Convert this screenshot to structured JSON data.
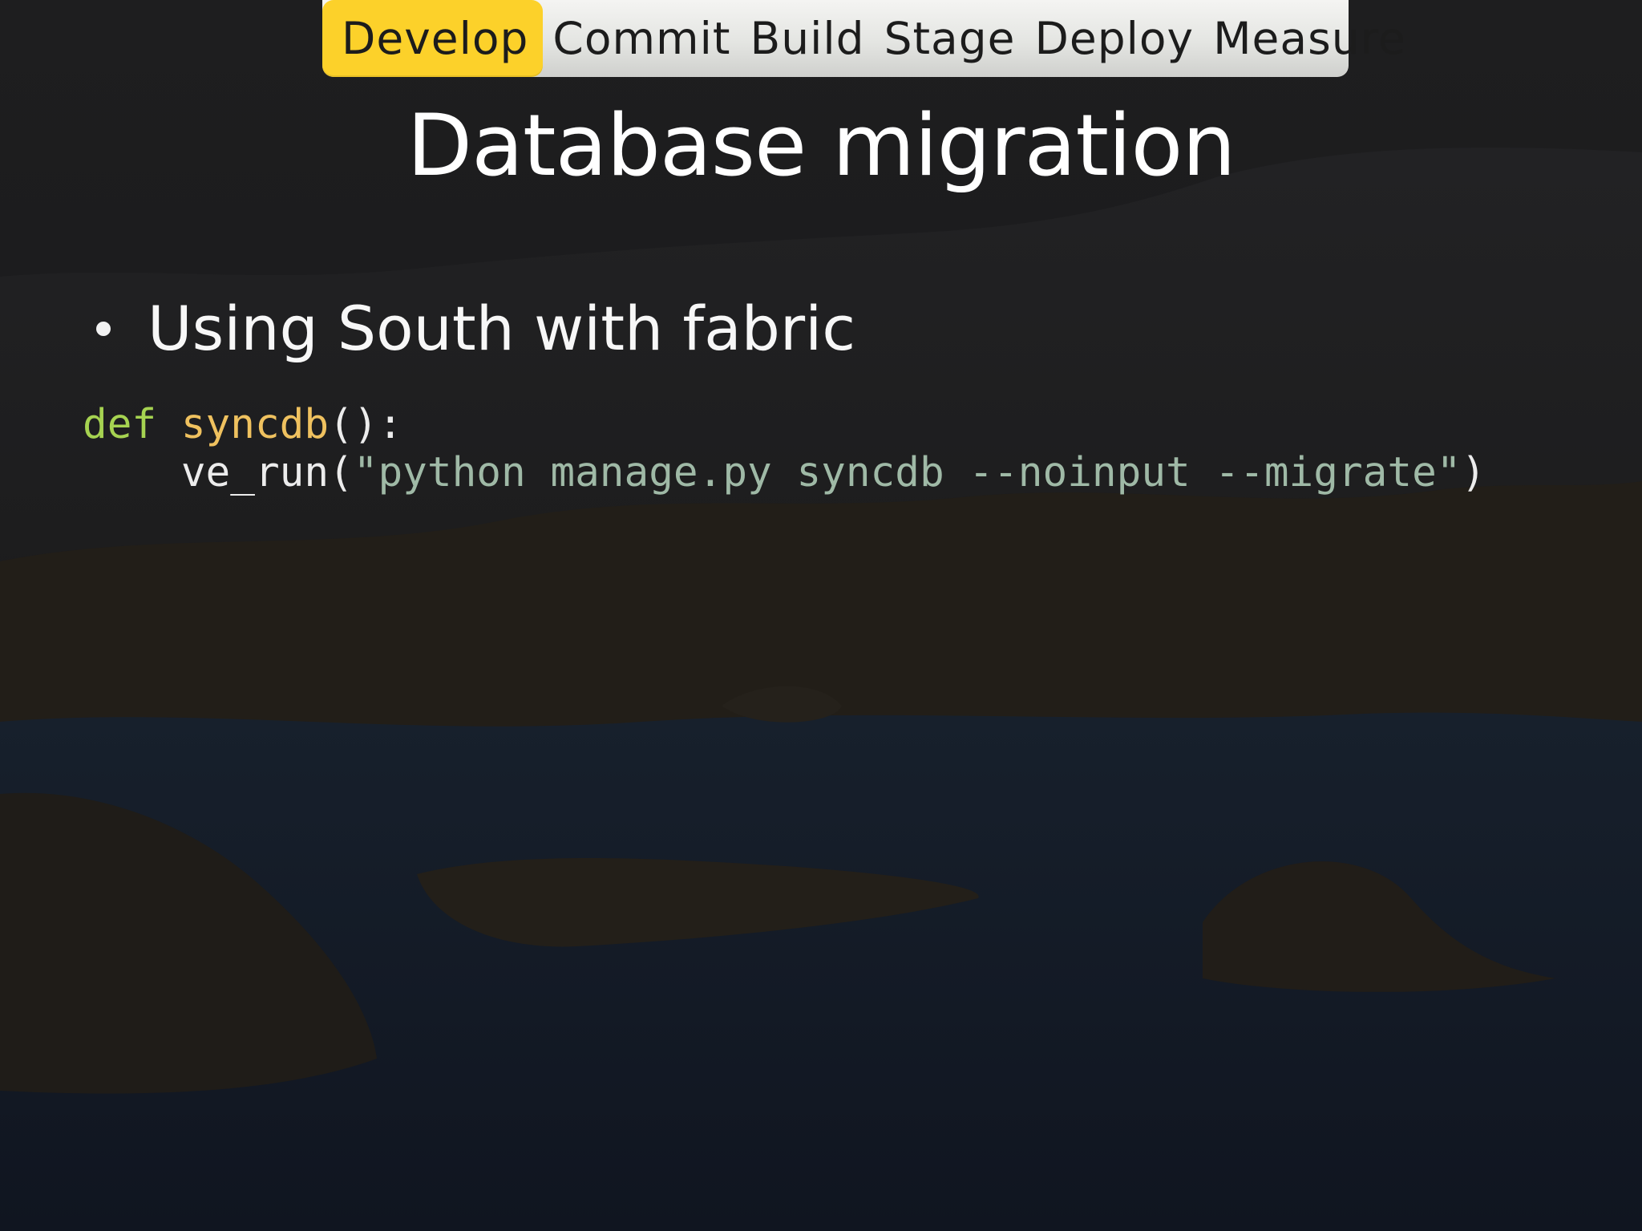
{
  "stages": {
    "items": [
      "Develop",
      "Commit",
      "Build",
      "Stage",
      "Deploy",
      "Measure"
    ],
    "active": "Develop",
    "active_color": "#fcd12a"
  },
  "slide": {
    "title": "Database migration",
    "bullets": [
      "Using South with fabric"
    ]
  },
  "code": {
    "language": "python",
    "line1": {
      "keyword": "def",
      "function": "syncdb",
      "rest": "():"
    },
    "line2": {
      "indent": "    ",
      "call": "ve_run(",
      "string": "\"python manage.py syncdb --noinput --migrate\"",
      "close": ")"
    },
    "colors": {
      "keyword": "#a6d351",
      "function": "#efc15f",
      "string": "#9fb9a6"
    }
  }
}
